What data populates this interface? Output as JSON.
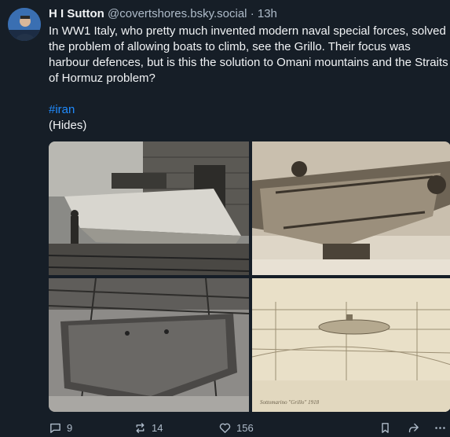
{
  "post": {
    "author": {
      "display_name": "H I Sutton",
      "handle": "@covertshores.bsky.social",
      "separator": "·",
      "time": "13h"
    },
    "text": {
      "paragraph": "In WW1 Italy, who pretty much invented modern naval special forces, solved the problem of allowing boats to climb, see the Grillo. Their focus was harbour defences, but is this the solution to Omani mountains and the Straits of Hormuz problem?",
      "hashtag": "#iran",
      "aside": "(Hides)"
    },
    "images": {
      "caption_on_sketch": "Sottomarino \"Grillo\" 1918"
    },
    "actions": {
      "reply_count": "9",
      "repost_count": "14",
      "like_count": "156"
    },
    "icons": [
      "reply-icon",
      "repost-icon",
      "like-icon",
      "bookmark-icon",
      "share-icon",
      "more-icon"
    ],
    "colors": {
      "background": "#161e27",
      "text": "#f1f3f5",
      "muted": "#aebbc9",
      "link": "#208bfe"
    }
  }
}
